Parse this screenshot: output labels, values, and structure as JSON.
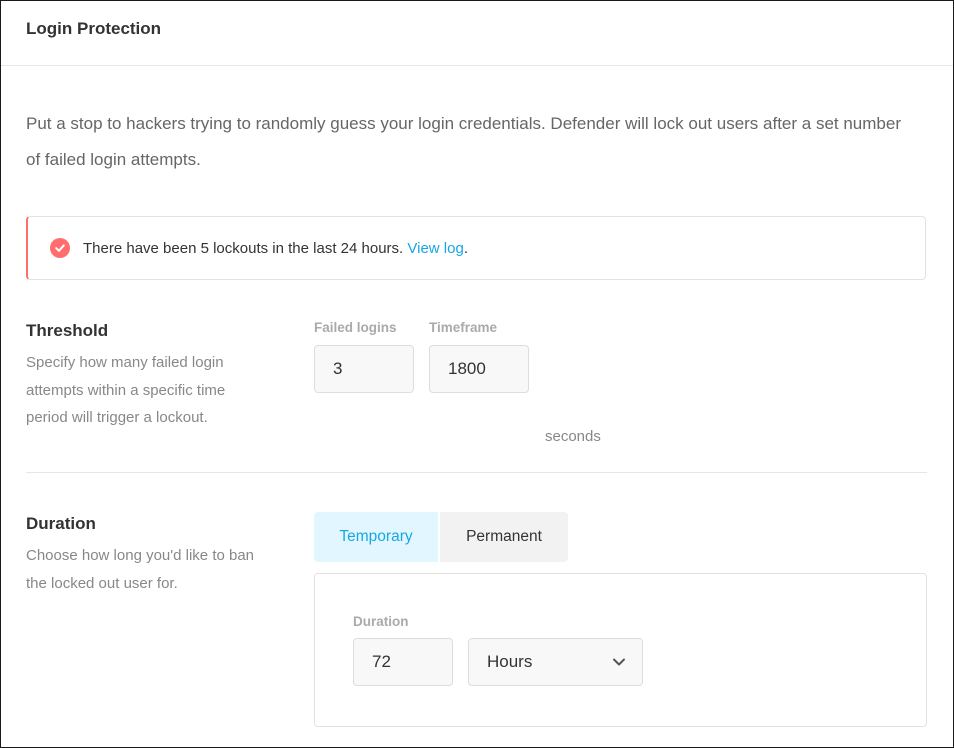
{
  "header": {
    "title": "Login Protection"
  },
  "intro": "Put a stop to hackers trying to randomly guess your login credentials. Defender will lock out users after a set number of failed login attempts.",
  "notice": {
    "text": "There have been 5 lockouts in the last 24 hours. ",
    "link": "View log",
    "suffix": ".",
    "icon": "check-circle-icon",
    "color": "#ff6d6d"
  },
  "threshold": {
    "title": "Threshold",
    "description": "Specify how many failed login attempts within a specific time period will trigger a lockout.",
    "failed_logins_label": "Failed logins",
    "failed_logins_value": "3",
    "timeframe_label": "Timeframe",
    "timeframe_value": "1800",
    "timeframe_unit": "seconds"
  },
  "duration": {
    "title": "Duration",
    "description": "Choose how long you'd like to ban the locked out user for.",
    "tabs": [
      {
        "label": "Temporary",
        "active": true
      },
      {
        "label": "Permanent",
        "active": false
      }
    ],
    "duration_label": "Duration",
    "duration_value": "72",
    "unit_selected": "Hours"
  },
  "colors": {
    "accent": "#17a8e3",
    "active_tab_bg": "#e1f6ff",
    "error": "#ff6d6d"
  }
}
